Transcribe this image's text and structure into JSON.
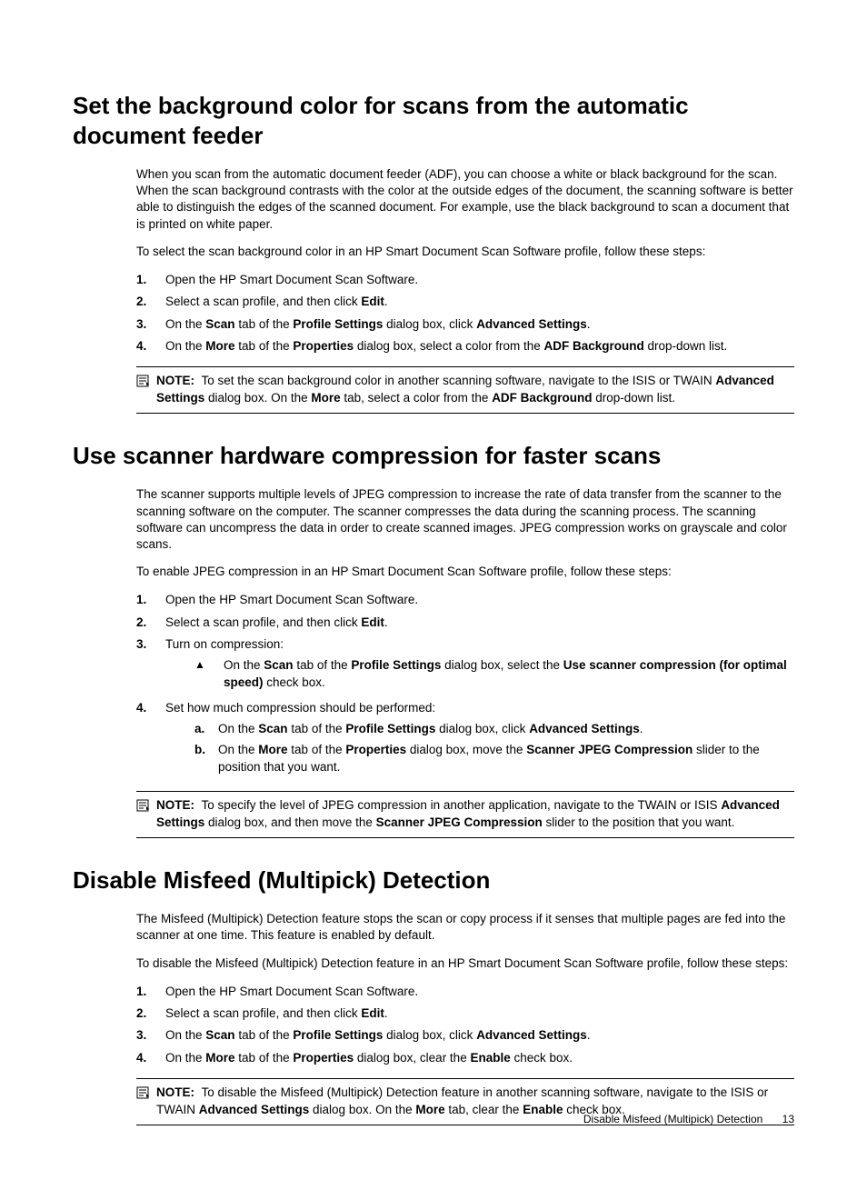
{
  "section1": {
    "heading": "Set the background color for scans from the automatic document feeder",
    "para1": "When you scan from the automatic document feeder (ADF), you can choose a white or black background for the scan. When the scan background contrasts with the color at the outside edges of the document, the scanning software is better able to distinguish the edges of the scanned document. For example, use the black background to scan a document that is printed on white paper.",
    "para2": "To select the scan background color in an HP Smart Document Scan Software profile, follow these steps:",
    "steps": {
      "s1": "Open the HP Smart Document Scan Software.",
      "s2_pre": "Select a scan profile, and then click ",
      "s2_b1": "Edit",
      "s2_post": ".",
      "s3_t1": "On the ",
      "s3_b1": "Scan",
      "s3_t2": " tab of the ",
      "s3_b2": "Profile Settings",
      "s3_t3": " dialog box, click ",
      "s3_b3": "Advanced Settings",
      "s3_t4": ".",
      "s4_t1": "On the ",
      "s4_b1": "More",
      "s4_t2": " tab of the ",
      "s4_b2": "Properties",
      "s4_t3": " dialog box, select a color from the ",
      "s4_b3": "ADF Background",
      "s4_t4": " drop-down list."
    },
    "note": {
      "label": "NOTE:",
      "t1": "To set the scan background color in another scanning software, navigate to the ISIS or TWAIN ",
      "b1": "Advanced Settings",
      "t2": " dialog box. On the ",
      "b2": "More",
      "t3": " tab, select a color from the ",
      "b3": "ADF Background",
      "t4": " drop-down list."
    }
  },
  "section2": {
    "heading": "Use scanner hardware compression for faster scans",
    "para1": "The scanner supports multiple levels of JPEG compression to increase the rate of data transfer from the scanner to the scanning software on the computer. The scanner compresses the data during the scanning process. The scanning software can uncompress the data in order to create scanned images. JPEG compression works on grayscale and color scans.",
    "para2": "To enable JPEG compression in an HP Smart Document Scan Software profile, follow these steps:",
    "steps": {
      "s1": "Open the HP Smart Document Scan Software.",
      "s2_pre": "Select a scan profile, and then click ",
      "s2_b1": "Edit",
      "s2_post": ".",
      "s3": "Turn on compression:",
      "s3a_t1": "On the ",
      "s3a_b1": "Scan",
      "s3a_t2": " tab of the ",
      "s3a_b2": "Profile Settings",
      "s3a_t3": " dialog box, select the ",
      "s3a_b3": "Use scanner compression (for optimal speed)",
      "s3a_t4": " check box.",
      "s4": "Set how much compression should be performed:",
      "s4a_t1": "On the ",
      "s4a_b1": "Scan",
      "s4a_t2": " tab of the ",
      "s4a_b2": "Profile Settings",
      "s4a_t3": " dialog box, click ",
      "s4a_b3": "Advanced Settings",
      "s4a_t4": ".",
      "s4b_t1": "On the ",
      "s4b_b1": "More",
      "s4b_t2": " tab of the ",
      "s4b_b2": "Properties",
      "s4b_t3": " dialog box, move the ",
      "s4b_b3": "Scanner JPEG Compression",
      "s4b_t4": " slider to the position that you want."
    },
    "note": {
      "label": "NOTE:",
      "t1": "To specify the level of JPEG compression in another application, navigate to the TWAIN or ISIS ",
      "b1": "Advanced Settings",
      "t2": " dialog box, and then move the ",
      "b2": "Scanner JPEG Compression",
      "t3": " slider to the position that you want."
    }
  },
  "section3": {
    "heading": "Disable Misfeed (Multipick) Detection",
    "para1": "The Misfeed (Multipick) Detection feature stops the scan or copy process if it senses that multiple pages are fed into the scanner at one time. This feature is enabled by default.",
    "para2": "To disable the Misfeed (Multipick) Detection feature in an HP Smart Document Scan Software profile, follow these steps:",
    "steps": {
      "s1": "Open the HP Smart Document Scan Software.",
      "s2_pre": "Select a scan profile, and then click ",
      "s2_b1": "Edit",
      "s2_post": ".",
      "s3_t1": "On the ",
      "s3_b1": "Scan",
      "s3_t2": " tab of the ",
      "s3_b2": "Profile Settings",
      "s3_t3": " dialog box, click ",
      "s3_b3": "Advanced Settings",
      "s3_t4": ".",
      "s4_t1": "On the ",
      "s4_b1": "More",
      "s4_t2": " tab of the ",
      "s4_b2": "Properties",
      "s4_t3": " dialog box, clear the ",
      "s4_b3": "Enable",
      "s4_t4": " check box."
    },
    "note": {
      "label": "NOTE:",
      "t1": "To disable the Misfeed (Multipick) Detection feature in another scanning software, navigate to the ISIS or TWAIN ",
      "b1": "Advanced Settings",
      "t2": " dialog box. On the ",
      "b2": "More",
      "t3": " tab, clear the ",
      "b3": "Enable",
      "t4": " check box."
    }
  },
  "footer": {
    "text": "Disable Misfeed (Multipick) Detection",
    "page": "13"
  },
  "labels": {
    "n1": "1.",
    "n2": "2.",
    "n3": "3.",
    "n4": "4.",
    "la": "a",
    "lb": "b",
    "ladot": ".",
    "lbdot": ".",
    "tri": "▲"
  }
}
